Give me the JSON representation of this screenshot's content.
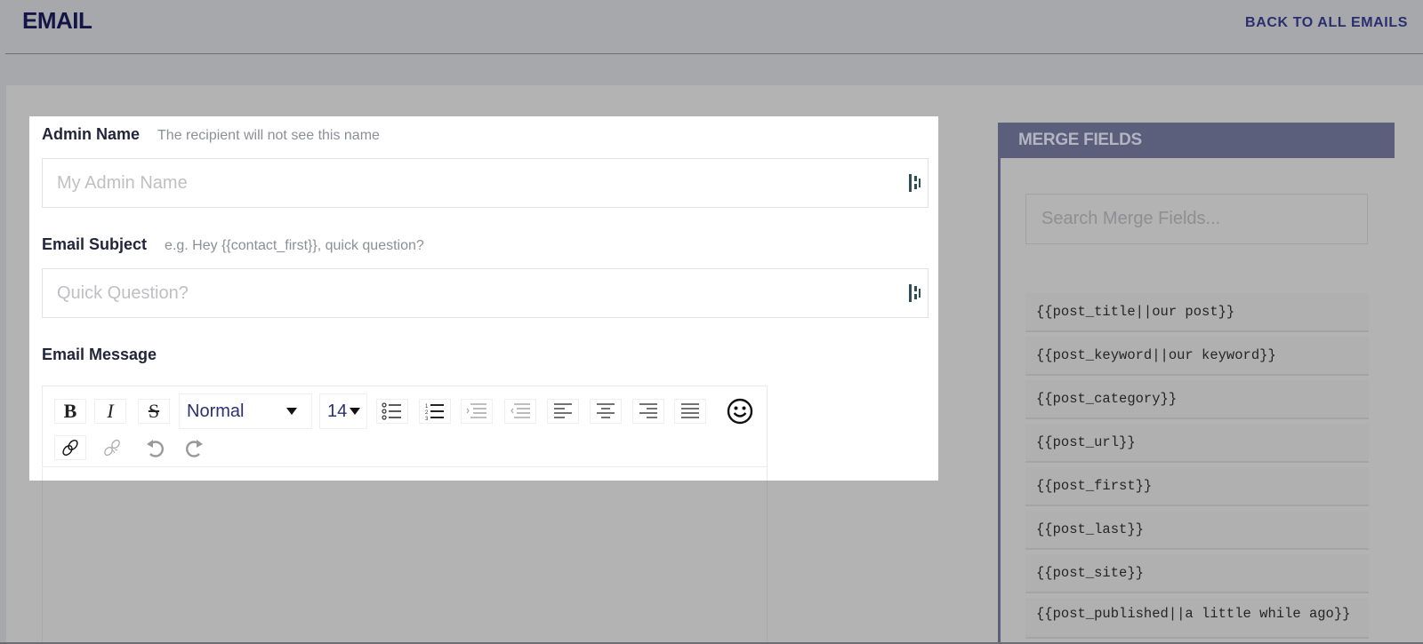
{
  "header": {
    "title": "EMAIL",
    "back_link": "BACK TO ALL EMAILS"
  },
  "form": {
    "admin_name": {
      "label": "Admin Name",
      "hint": "The recipient will not see this name",
      "value": "",
      "placeholder": "My Admin Name"
    },
    "email_subject": {
      "label": "Email Subject",
      "hint": "e.g. Hey {{contact_first}}, quick question?",
      "value": "",
      "placeholder": "Quick Question?"
    },
    "email_message": {
      "label": "Email Message"
    }
  },
  "editor": {
    "toolbar": {
      "bold": "B",
      "italic": "I",
      "strike": "S",
      "format_selected": "Normal",
      "size_selected": "14",
      "icons": [
        "bold-icon",
        "italic-icon",
        "strikethrough-icon",
        "bullet-list-icon",
        "numbered-list-icon",
        "indent-icon",
        "outdent-icon",
        "align-left-icon",
        "align-center-icon",
        "align-right-icon",
        "align-justify-icon",
        "emoji-icon",
        "link-icon",
        "unlink-icon",
        "undo-icon",
        "redo-icon"
      ]
    },
    "body": ""
  },
  "merge_fields": {
    "title": "MERGE FIELDS",
    "search_placeholder": "Search Merge Fields...",
    "search_value": "",
    "items": [
      "{{post_title||our post}}",
      "{{post_keyword||our keyword}}",
      "{{post_category}}",
      "{{post_url}}",
      "{{post_first}}",
      "{{post_last}}",
      "{{post_site}}",
      "{{post_published||a little while ago}}"
    ]
  },
  "colors": {
    "title": "#141547",
    "link": "#2a2e6e",
    "merge_header": "#5c5f7c",
    "overlay": "#b3b3b3"
  }
}
